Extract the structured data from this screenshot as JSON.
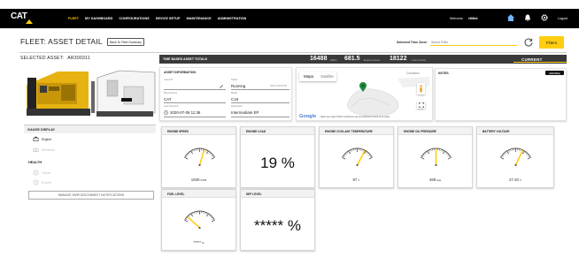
{
  "nav": {
    "logo": "CAT",
    "items": [
      "FLEET",
      "MY DASHBOARD",
      "CONFIGURATIONS",
      "DEVICE SETUP",
      "MAINTENANCE",
      "ADMINISTRATION"
    ],
    "welcome": "Welcome",
    "user": "r9l8b4",
    "logout": "Logout"
  },
  "page": {
    "title": "FLEET: ASSET DETAIL",
    "back_button": "Back To Fleet Summary",
    "time_zone_label": "Selected Time Zone:",
    "time_zone_placeholder": "Select Filter",
    "filters_button": "Filters",
    "selected_asset_label": "SELECTED ASSET:",
    "selected_asset": "AR300311"
  },
  "totals": {
    "label": "TIME BASED ASSET TOTALS",
    "items": [
      {
        "value": "16488",
        "unit": "kWhs"
      },
      {
        "value": "681.5",
        "unit": "Engine Hours"
      },
      {
        "value": "18122",
        "unit": "Fuel (Litres)"
      }
    ],
    "current": "CURRENT"
  },
  "asset_info": {
    "header": "ASSET INFORMATION",
    "fields": [
      {
        "label": "Asset ID",
        "value": ""
      },
      {
        "label": "Status",
        "value": "Running",
        "note": "2020-07-06 09:36"
      },
      {
        "label": "Manufacturer",
        "value": "CAT"
      },
      {
        "label": "Model",
        "value": "C18"
      },
      {
        "label": "Last Reported",
        "value": "2020-07-06 11:36"
      },
      {
        "label": "Description",
        "value": "Intermediate EP"
      }
    ]
  },
  "map": {
    "tab_map": "Mapa",
    "tab_satellite": "Satélite",
    "place": "Comodoro",
    "google": "Google",
    "footer": "Datos del mapa ©2020  Condiciones del uso  Informar un error en el mapa"
  },
  "notes": {
    "header": "NOTES",
    "add_button": "Add Note"
  },
  "sidebar": {
    "gauge_display": "GAUGE DISPLAY",
    "items": [
      {
        "label": "Engine",
        "enabled": true
      },
      {
        "label": "Electrical",
        "enabled": false
      }
    ],
    "health": "HEALTH",
    "health_items": [
      {
        "label": "Faults",
        "enabled": false
      },
      {
        "label": "Events",
        "enabled": false
      }
    ],
    "manage_button": "MANAGE 3WIR DISCONNECT NOTIFICATIONS"
  },
  "gauges": [
    {
      "title": "ENGINE SPEED",
      "type": "dial",
      "value": "1835",
      "unit": "RPM",
      "fraction": 0.63
    },
    {
      "title": "ENGINE LOAD",
      "type": "text",
      "value": "19 %"
    },
    {
      "title": "ENGINE COOLANT TEMPERATURE",
      "type": "dial",
      "value": "87",
      "unit": "C",
      "fraction": 0.72
    },
    {
      "title": "ENGINE OIL PRESSURE",
      "type": "dial",
      "value": "468",
      "unit": "kpa",
      "fraction": 0.5
    },
    {
      "title": "BATTERY VOLTAGE",
      "type": "dial",
      "value": "27.40",
      "unit": "V",
      "fraction": 0.7
    },
    {
      "title": "FUEL LEVEL",
      "type": "dial",
      "value": "*****",
      "unit": "%",
      "fraction": 0.12
    },
    {
      "title": "DEF LEVEL",
      "type": "text",
      "value": "***** %"
    }
  ],
  "colors": {
    "accent": "#ffcd11",
    "nav_bg": "#000000",
    "totals_bg": "#3a3a3a",
    "map_marker": "#1e8a3a"
  }
}
